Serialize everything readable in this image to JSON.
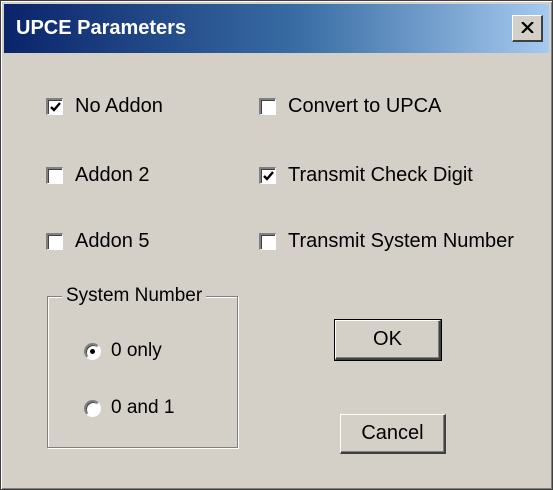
{
  "window": {
    "title": "UPCE Parameters"
  },
  "options": {
    "no_addon": {
      "label": "No Addon",
      "checked": true
    },
    "addon_2": {
      "label": "Addon 2",
      "checked": false
    },
    "addon_5": {
      "label": "Addon 5",
      "checked": false
    },
    "convert_to_upca": {
      "label": "Convert to UPCA",
      "checked": false
    },
    "transmit_check_digit": {
      "label": "Transmit Check Digit",
      "checked": true
    },
    "transmit_system_number": {
      "label": "Transmit System Number",
      "checked": false
    }
  },
  "system_number": {
    "legend": "System Number",
    "options": [
      {
        "label": "0 only",
        "selected": true
      },
      {
        "label": "0 and 1",
        "selected": false
      }
    ]
  },
  "buttons": {
    "ok": "OK",
    "cancel": "Cancel"
  },
  "colors": {
    "dialog_face": "#d4d0c8",
    "titlebar_start": "#0a246a",
    "titlebar_end": "#a6caf0"
  }
}
